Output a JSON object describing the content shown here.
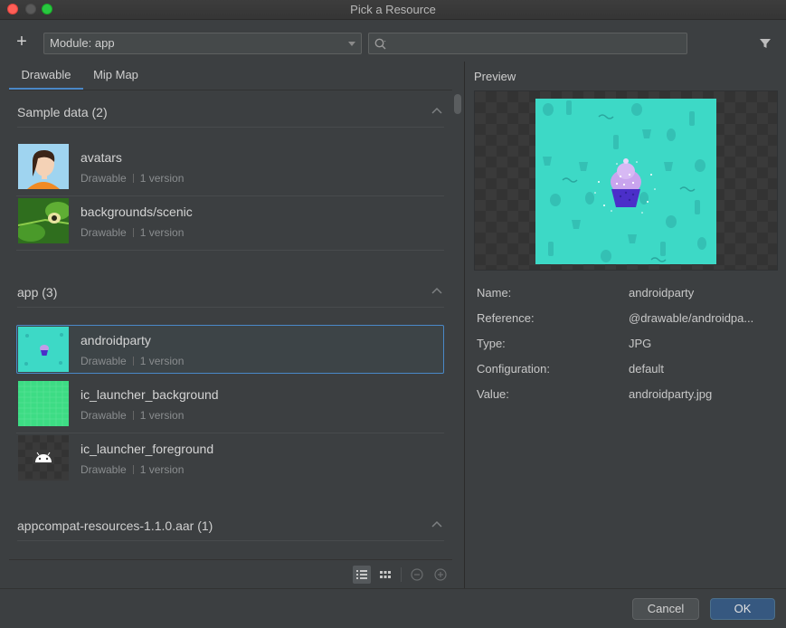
{
  "window": {
    "title": "Pick a Resource"
  },
  "toolbar": {
    "add_label": "+",
    "module_label": "Module: app",
    "search_placeholder": "",
    "search_value": ""
  },
  "tabs": [
    {
      "label": "Drawable",
      "active": true
    },
    {
      "label": "Mip Map",
      "active": false
    }
  ],
  "sections": [
    {
      "title": "Sample data (2)",
      "items": [
        {
          "name": "avatars",
          "type": "Drawable",
          "versions": "1 version",
          "icon": "avatar-thumbnail"
        },
        {
          "name": "backgrounds/scenic",
          "type": "Drawable",
          "versions": "1 version",
          "icon": "scenic-thumbnail"
        }
      ]
    },
    {
      "title": "app (3)",
      "items": [
        {
          "name": "androidparty",
          "type": "Drawable",
          "versions": "1 version",
          "icon": "cupcake-thumbnail",
          "selected": true
        },
        {
          "name": "ic_launcher_background",
          "type": "Drawable",
          "versions": "1 version",
          "icon": "green-grid-thumbnail"
        },
        {
          "name": "ic_launcher_foreground",
          "type": "Drawable",
          "versions": "1 version",
          "icon": "android-head-thumbnail"
        }
      ]
    },
    {
      "title": "appcompat-resources-1.1.0.aar (1)",
      "items": []
    }
  ],
  "preview": {
    "label": "Preview",
    "properties": [
      {
        "label": "Name:",
        "value": "androidparty"
      },
      {
        "label": "Reference:",
        "value": "@drawable/androidpa..."
      },
      {
        "label": "Type:",
        "value": "JPG"
      },
      {
        "label": "Configuration:",
        "value": "default"
      },
      {
        "label": "Value:",
        "value": "androidparty.jpg"
      }
    ]
  },
  "buttons": {
    "cancel": "Cancel",
    "ok": "OK"
  },
  "colors": {
    "accent": "#4a88c7",
    "background": "#3c3f41",
    "ok_button": "#365880",
    "preview_teal": "#3dd9c6"
  }
}
